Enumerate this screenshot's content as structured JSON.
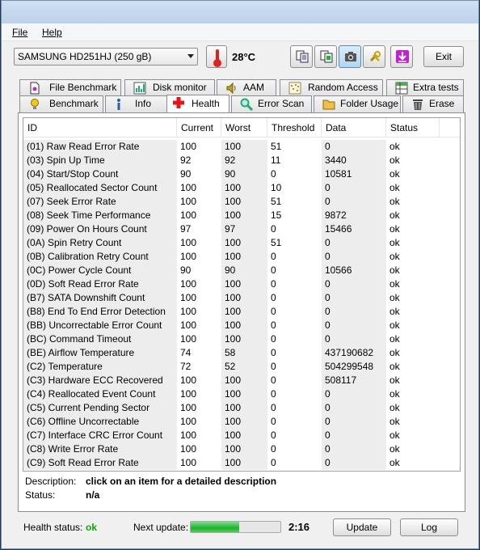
{
  "menu": {
    "file": "File",
    "help": "Help"
  },
  "toolbar": {
    "drive": "SAMSUNG HD251HJ (250 gB)",
    "temperature": "28°C",
    "exit_label": "Exit",
    "icons": [
      "copy-text-icon",
      "copy-all-icon",
      "screenshot-icon",
      "options-icon",
      "download-icon"
    ]
  },
  "tabs_top": [
    "File Benchmark",
    "Disk monitor",
    "AAM",
    "Random Access",
    "Extra tests"
  ],
  "tabs_bottom": [
    "Benchmark",
    "Info",
    "Health",
    "Error Scan",
    "Folder Usage",
    "Erase"
  ],
  "active_tab": "Health",
  "columns": [
    "ID",
    "Current",
    "Worst",
    "Threshold",
    "Data",
    "Status"
  ],
  "rows": [
    [
      "(01) Raw Read Error Rate",
      "100",
      "100",
      "51",
      "0",
      "ok"
    ],
    [
      "(03) Spin Up Time",
      "92",
      "92",
      "11",
      "3440",
      "ok"
    ],
    [
      "(04) Start/Stop Count",
      "90",
      "90",
      "0",
      "10581",
      "ok"
    ],
    [
      "(05) Reallocated Sector Count",
      "100",
      "100",
      "10",
      "0",
      "ok"
    ],
    [
      "(07) Seek Error Rate",
      "100",
      "100",
      "51",
      "0",
      "ok"
    ],
    [
      "(08) Seek Time Performance",
      "100",
      "100",
      "15",
      "9872",
      "ok"
    ],
    [
      "(09) Power On Hours Count",
      "97",
      "97",
      "0",
      "15466",
      "ok"
    ],
    [
      "(0A) Spin Retry Count",
      "100",
      "100",
      "51",
      "0",
      "ok"
    ],
    [
      "(0B) Calibration Retry Count",
      "100",
      "100",
      "0",
      "0",
      "ok"
    ],
    [
      "(0C) Power Cycle Count",
      "90",
      "90",
      "0",
      "10566",
      "ok"
    ],
    [
      "(0D) Soft Read Error Rate",
      "100",
      "100",
      "0",
      "0",
      "ok"
    ],
    [
      "(B7) SATA Downshift Count",
      "100",
      "100",
      "0",
      "0",
      "ok"
    ],
    [
      "(B8) End To End Error Detection",
      "100",
      "100",
      "0",
      "0",
      "ok"
    ],
    [
      "(BB) Uncorrectable Error Count",
      "100",
      "100",
      "0",
      "0",
      "ok"
    ],
    [
      "(BC) Command Timeout",
      "100",
      "100",
      "0",
      "0",
      "ok"
    ],
    [
      "(BE) Airflow Temperature",
      "74",
      "58",
      "0",
      "437190682",
      "ok"
    ],
    [
      "(C2) Temperature",
      "72",
      "52",
      "0",
      "504299548",
      "ok"
    ],
    [
      "(C3) Hardware ECC Recovered",
      "100",
      "100",
      "0",
      "508117",
      "ok"
    ],
    [
      "(C4) Reallocated Event Count",
      "100",
      "100",
      "0",
      "0",
      "ok"
    ],
    [
      "(C5) Current Pending Sector",
      "100",
      "100",
      "0",
      "0",
      "ok"
    ],
    [
      "(C6) Offline Uncorrectable",
      "100",
      "100",
      "0",
      "0",
      "ok"
    ],
    [
      "(C7) Interface CRC Error Count",
      "100",
      "100",
      "0",
      "0",
      "ok"
    ],
    [
      "(C8) Write Error Rate",
      "100",
      "100",
      "0",
      "0",
      "ok"
    ],
    [
      "(C9) Soft Read Error Rate",
      "100",
      "100",
      "0",
      "0",
      "ok"
    ]
  ],
  "description": {
    "label": "Description:",
    "value": "click on an item for a detailed description"
  },
  "status": {
    "label": "Status:",
    "value": "n/a"
  },
  "footer": {
    "health_label": "Health status:",
    "health_value": "ok",
    "next_update_label": "Next update:",
    "progress_fraction": 0.54,
    "timer": "2:16",
    "update_label": "Update",
    "log_label": "Log"
  },
  "colors": {
    "health_ok": "#12a312",
    "progress": "#20b030"
  }
}
